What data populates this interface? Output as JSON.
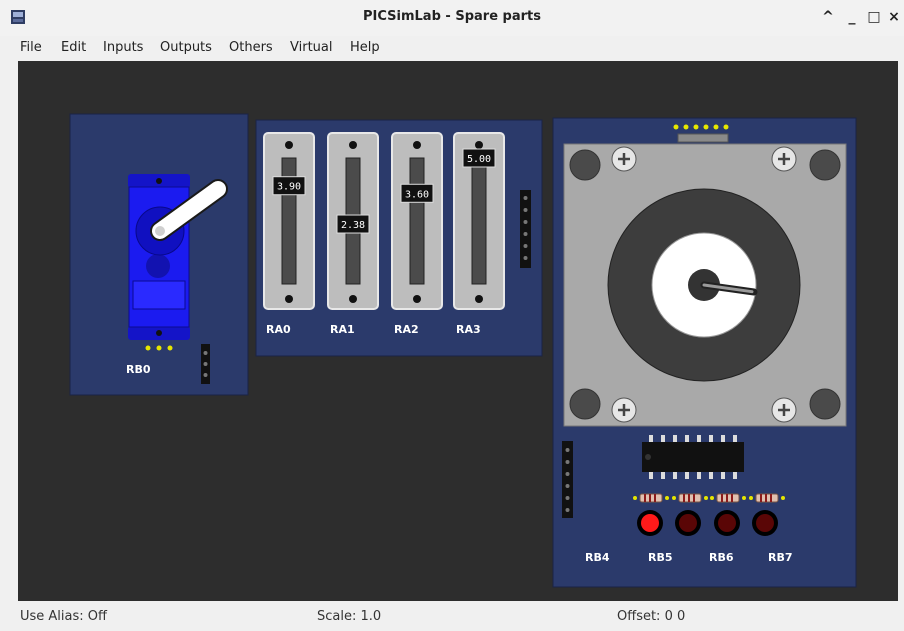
{
  "window": {
    "title": "PICSimLab - Spare parts"
  },
  "window_controls": {
    "restore": "^",
    "minimize": "_",
    "maximize": "□",
    "close": "×"
  },
  "menu": [
    "File",
    "Edit",
    "Inputs",
    "Outputs",
    "Others",
    "Virtual",
    "Help"
  ],
  "parts": {
    "servo": {
      "label": "RB0"
    },
    "potentiometers": [
      {
        "label": "RA0",
        "value": "3.90",
        "fraction": 0.78
      },
      {
        "label": "RA1",
        "value": "2.38",
        "fraction": 0.476
      },
      {
        "label": "RA2",
        "value": "3.60",
        "fraction": 0.72
      },
      {
        "label": "RA3",
        "value": "5.00",
        "fraction": 1.0
      }
    ],
    "stepper": {
      "labels": [
        "RB4",
        "RB5",
        "RB6",
        "RB7"
      ],
      "leds": [
        {
          "name": "RB4",
          "on": true
        },
        {
          "name": "RB5",
          "on": false
        },
        {
          "name": "RB6",
          "on": false
        },
        {
          "name": "RB7",
          "on": false
        }
      ]
    }
  },
  "colors": {
    "board": "#2b3a6b",
    "led_on": "#ff1a1a",
    "led_off": "#5a0606",
    "servo": "#1b1bf0"
  },
  "status": {
    "alias": "Use Alias: Off",
    "scale": "Scale: 1.0",
    "offset": "Offset:  0  0"
  }
}
